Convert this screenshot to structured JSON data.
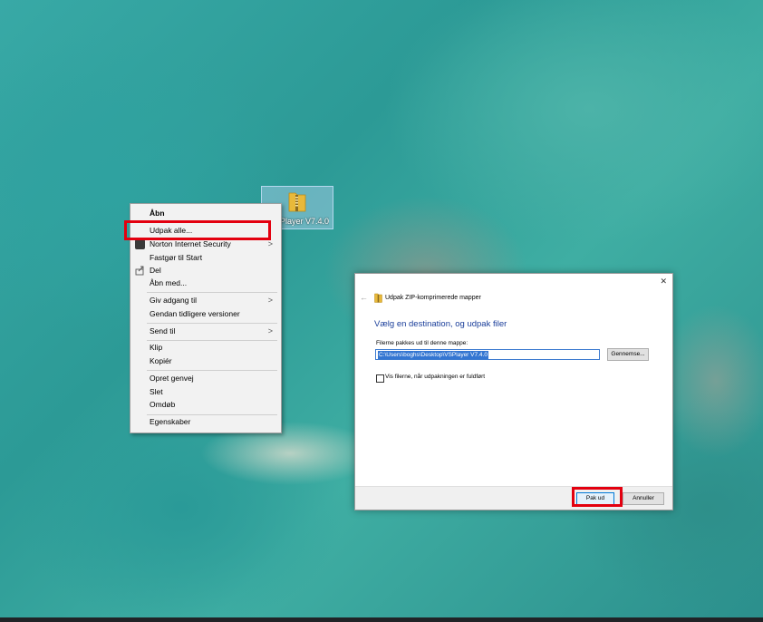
{
  "desktop": {
    "zip_file_label": "VSPlayer V7.4.0.zip"
  },
  "context_menu": {
    "items": [
      {
        "label": "Åbn",
        "bold": true
      },
      {
        "label": "Udpak alle..."
      },
      {
        "label": "Norton Internet Security",
        "icon": "norton-icon",
        "submenu": true
      },
      {
        "label": "Fastgør til Start"
      },
      {
        "label": "Del",
        "icon": "share-icon"
      },
      {
        "label": "Åbn med..."
      },
      {
        "label": "Giv adgang til",
        "submenu": true
      },
      {
        "label": "Gendan tidligere versioner"
      },
      {
        "label": "Send til",
        "submenu": true
      },
      {
        "label": "Klip"
      },
      {
        "label": "Kopiér"
      },
      {
        "label": "Opret genvej"
      },
      {
        "label": "Slet"
      },
      {
        "label": "Omdøb"
      },
      {
        "label": "Egenskaber"
      }
    ],
    "submenu_arrow": ">"
  },
  "dialog": {
    "title": "Udpak ZIP-komprimerede mapper",
    "heading": "Vælg en destination, og udpak filer",
    "field_label": "Filerne pakkes ud til denne mappe:",
    "path_value": "C:\\Users\\boghs\\Desktop\\VSPlayer V7.4.0",
    "browse_label": "Gennemse...",
    "checkbox_label": "Vis filerne, når udpakningen er fuldført",
    "checkbox_checked": false,
    "extract_label": "Pak ud",
    "cancel_label": "Annuller",
    "close_glyph": "✕",
    "back_glyph": "←"
  },
  "colors": {
    "highlight": "#e3000f",
    "dialog_heading": "#1a3e9a",
    "selection": "#3476d2"
  }
}
